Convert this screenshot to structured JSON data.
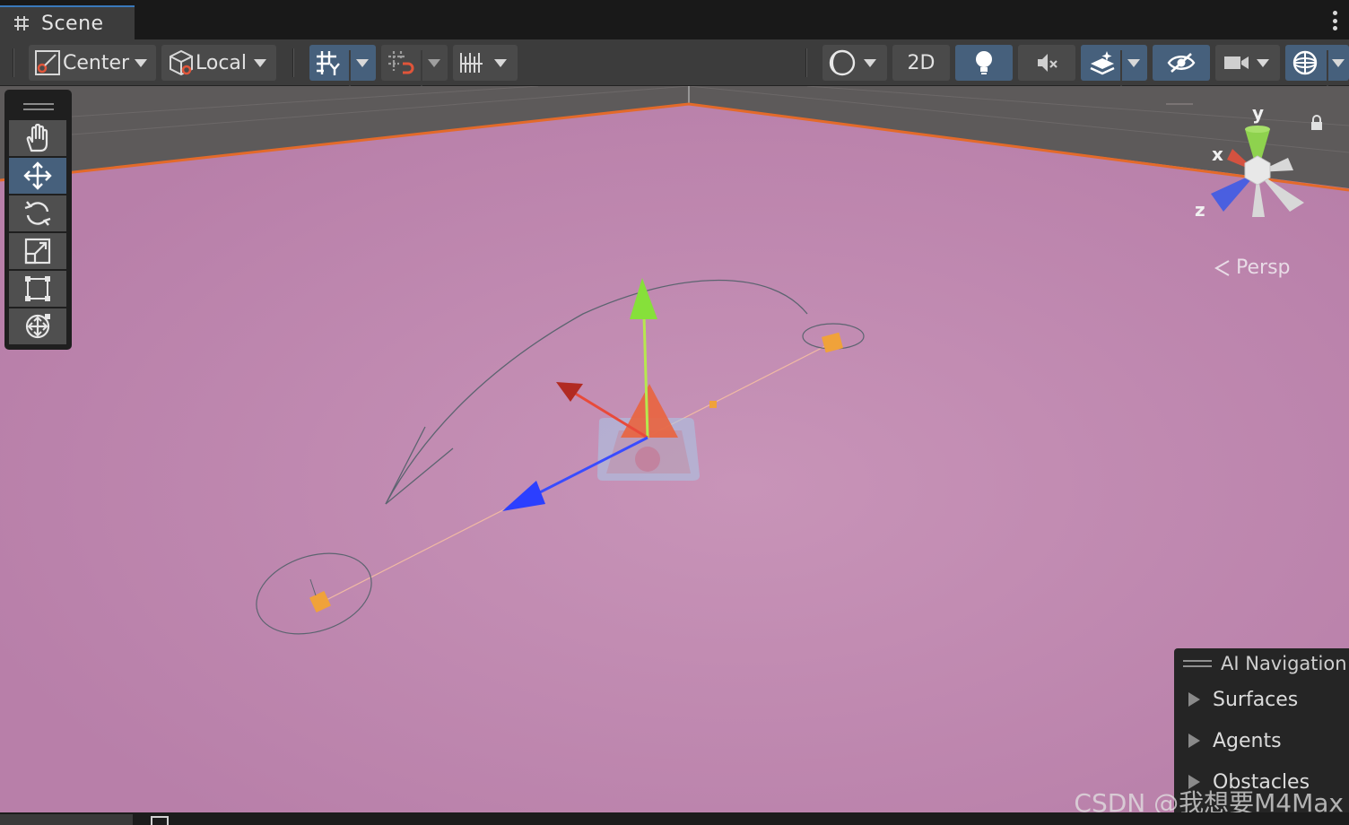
{
  "window": {
    "tab_label": "Scene",
    "tab_icon": "grid-hash-icon"
  },
  "toolbar": {
    "pivot_label": "Center",
    "space_label": "Local",
    "mode_2d_label": "2D",
    "accent_active": "#46607c"
  },
  "scene": {
    "projection_label": "Persp",
    "ground_color": "#bb86ae",
    "horizon_color": "#e36a2a",
    "gizmo": {
      "y_label": "y",
      "x_label": "x",
      "z_label": "z"
    }
  },
  "ai_navigation": {
    "title": "AI Navigation",
    "items": [
      {
        "label": "Surfaces"
      },
      {
        "label": "Agents"
      },
      {
        "label": "Obstacles"
      }
    ]
  },
  "watermark": "CSDN @我想要M4Max"
}
